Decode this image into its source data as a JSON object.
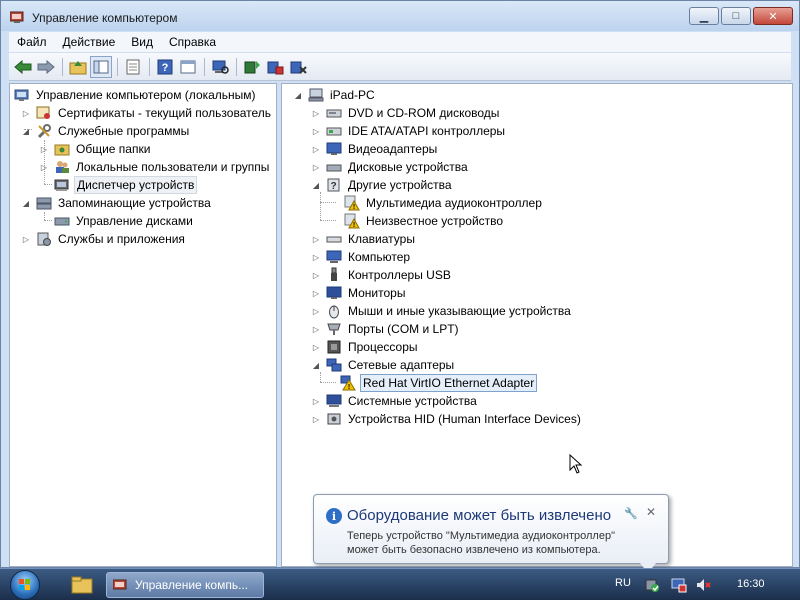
{
  "window": {
    "title": "Управление компьютером",
    "controls": {
      "minimize": "▁",
      "maximize": "□",
      "close": "✕"
    }
  },
  "menu": [
    "Файл",
    "Действие",
    "Вид",
    "Справка"
  ],
  "toolbar": {
    "icons": [
      "back-icon",
      "forward-icon",
      "up-folder-icon",
      "show-hide-tree-icon",
      "properties-icon",
      "help-icon",
      "action-pane-icon",
      "scan-hardware-icon",
      "update-driver-icon",
      "disable-device-icon",
      "uninstall-device-icon"
    ]
  },
  "left_tree": [
    {
      "label": "Управление компьютером (локальным)",
      "level": 0,
      "expander": "",
      "icon": "computer-management-icon"
    },
    {
      "label": "Сертификаты - текущий пользователь",
      "level": 1,
      "expander": "▷",
      "icon": "certificates-icon"
    },
    {
      "label": "Служебные программы",
      "level": 1,
      "expander": "◢",
      "icon": "tools-icon"
    },
    {
      "label": "Общие папки",
      "level": 2,
      "expander": "▷",
      "icon": "shared-folders-icon"
    },
    {
      "label": "Локальные пользователи и группы",
      "level": 2,
      "expander": "▷",
      "icon": "users-icon"
    },
    {
      "label": "Диспетчер устройств",
      "level": 2,
      "expander": "",
      "icon": "device-manager-icon",
      "selected": true
    },
    {
      "label": "Запоминающие устройства",
      "level": 1,
      "expander": "◢",
      "icon": "storage-icon"
    },
    {
      "label": "Управление дисками",
      "level": 2,
      "expander": "",
      "icon": "disk-management-icon"
    },
    {
      "label": "Службы и приложения",
      "level": 1,
      "expander": "▷",
      "icon": "services-icon"
    }
  ],
  "right_tree": [
    {
      "label": "iPad-PC",
      "level": 0,
      "expander": "◢",
      "icon": "computer-icon"
    },
    {
      "label": "DVD и CD-ROM дисководы",
      "level": 1,
      "expander": "▷",
      "icon": "dvd-drive-icon"
    },
    {
      "label": "IDE ATA/ATAPI контроллеры",
      "level": 1,
      "expander": "▷",
      "icon": "ide-controller-icon"
    },
    {
      "label": "Видеоадаптеры",
      "level": 1,
      "expander": "▷",
      "icon": "display-adapter-icon"
    },
    {
      "label": "Дисковые устройства",
      "level": 1,
      "expander": "▷",
      "icon": "disk-drive-icon"
    },
    {
      "label": "Другие устройства",
      "level": 1,
      "expander": "◢",
      "icon": "other-devices-icon"
    },
    {
      "label": "Мультимедиа аудиоконтроллер",
      "level": 2,
      "expander": "",
      "icon": "warning-device-icon"
    },
    {
      "label": "Неизвестное устройство",
      "level": 2,
      "expander": "",
      "icon": "warning-device-icon"
    },
    {
      "label": "Клавиатуры",
      "level": 1,
      "expander": "▷",
      "icon": "keyboard-icon"
    },
    {
      "label": "Компьютер",
      "level": 1,
      "expander": "▷",
      "icon": "computer-icon"
    },
    {
      "label": "Контроллеры USB",
      "level": 1,
      "expander": "▷",
      "icon": "usb-icon"
    },
    {
      "label": "Мониторы",
      "level": 1,
      "expander": "▷",
      "icon": "monitor-icon"
    },
    {
      "label": "Мыши и иные указывающие устройства",
      "level": 1,
      "expander": "▷",
      "icon": "mouse-icon"
    },
    {
      "label": "Порты (COM и LPT)",
      "level": 1,
      "expander": "▷",
      "icon": "port-icon"
    },
    {
      "label": "Процессоры",
      "level": 1,
      "expander": "▷",
      "icon": "processor-icon"
    },
    {
      "label": "Сетевые адаптеры",
      "level": 1,
      "expander": "◢",
      "icon": "network-adapter-icon"
    },
    {
      "label": "Red Hat VirtIO Ethernet Adapter",
      "level": 2,
      "expander": "",
      "icon": "warning-network-icon",
      "selected": true
    },
    {
      "label": "Системные устройства",
      "level": 1,
      "expander": "▷",
      "icon": "system-devices-icon"
    },
    {
      "label": "Устройства HID (Human Interface Devices)",
      "level": 1,
      "expander": "▷",
      "icon": "hid-icon"
    }
  ],
  "balloon": {
    "title": "Оборудование может быть извлечено",
    "line1": "Теперь устройство \"Мультимедиа аудиоконтроллер\"",
    "line2": "может быть безопасно извлечено из компьютера."
  },
  "taskbar": {
    "task_label": "Управление компь...",
    "language": "RU",
    "time": "16:30"
  },
  "colors": {
    "accent": "#2d6fc6",
    "warning": "#f2c200",
    "selection": "#e5eef9"
  }
}
